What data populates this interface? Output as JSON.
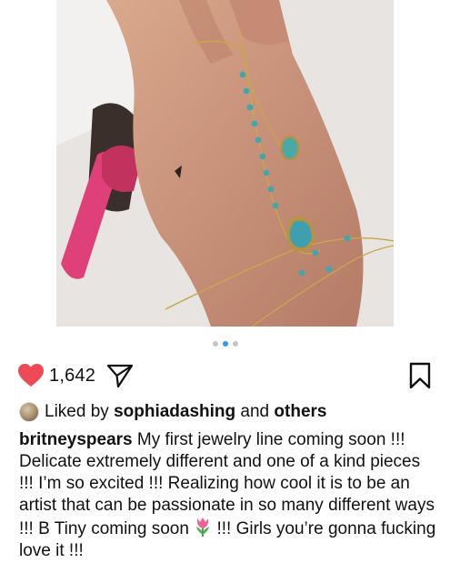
{
  "post": {
    "carousel": {
      "count": 3,
      "active_index": 1
    },
    "actions": {
      "like_count": "1,642",
      "heart_color": "#ed4956"
    },
    "liked_by": {
      "prefix": "Liked by",
      "user": "sophiadashing",
      "joiner": "and",
      "others": "others"
    },
    "caption": {
      "username": "britneyspears",
      "text_before_emoji": "My first jewelry line coming soon !!! Delicate extremely different and one of a kind pieces !!! I’m so excited !!! Realizing how cool it is to be an artist that can be passionate in so many different ways !!! B Tiny coming soon ",
      "emoji_icon": "tulip",
      "text_after_emoji": " !!! Girls you’re gonna fucking love it !!!"
    }
  }
}
